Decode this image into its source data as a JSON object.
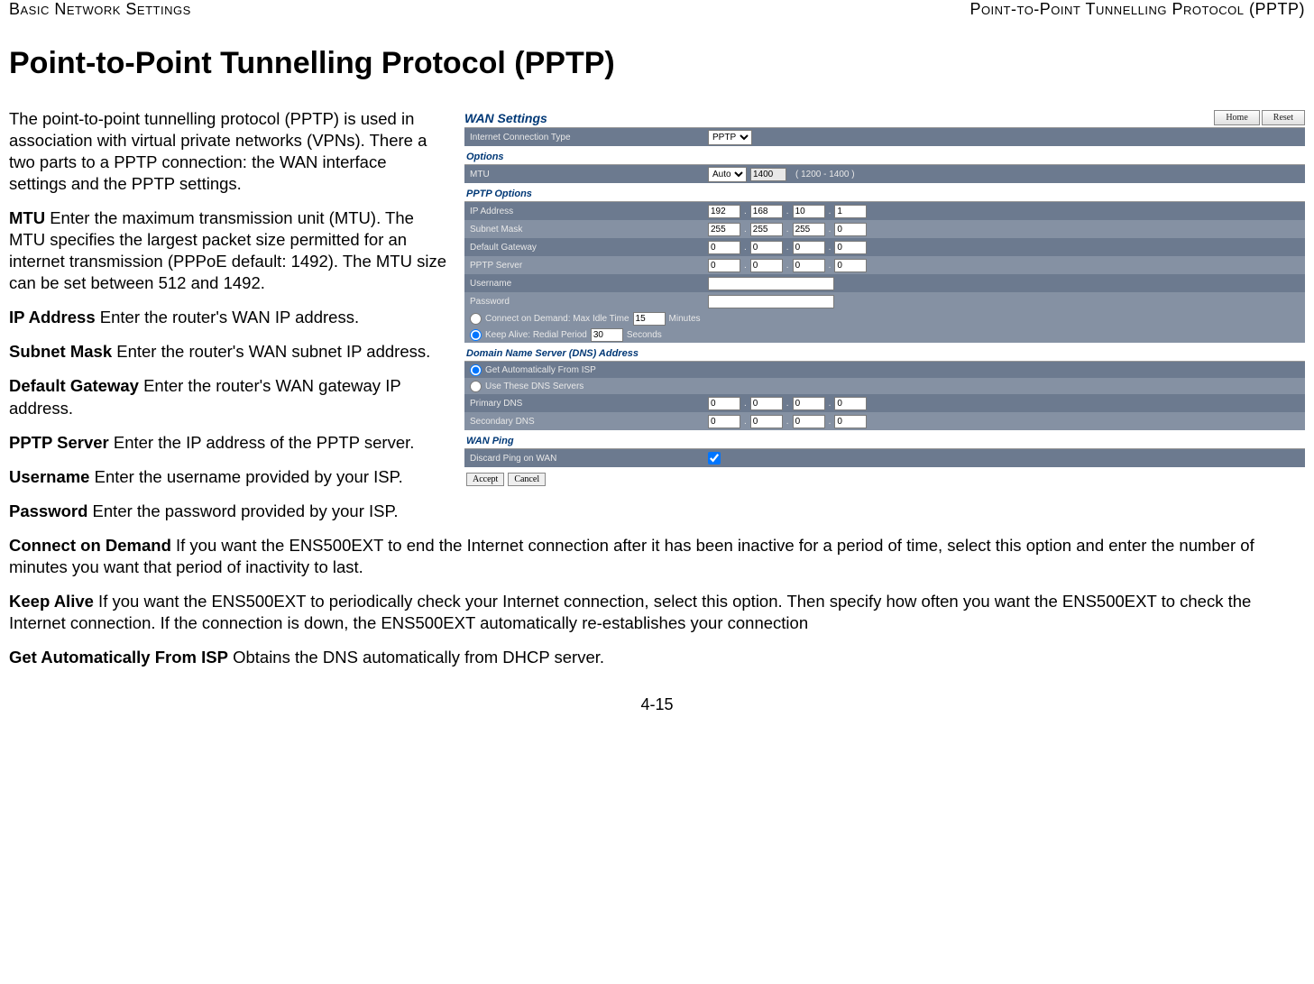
{
  "header": {
    "left": "Basic Network Settings",
    "right": "Point-to-Point Tunnelling Protocol (PPTP)"
  },
  "title": "Point-to-Point Tunnelling Protocol (PPTP)",
  "intro": "The point-to-point tunnelling protocol (PPTP) is used in association with virtual private networks (VPNs). There a two parts to a PPTP connection: the WAN interface settings and the PPTP settings.",
  "mtu": {
    "label": "MTU",
    "text": "  Enter the maximum transmission unit (MTU). The MTU specifies the largest packet size permitted for an internet transmission (PPPoE default: 1492). The MTU size can be set between 512 and 1492."
  },
  "ip": {
    "label": "IP Address",
    "text": "  Enter the router's WAN IP address."
  },
  "subnet": {
    "label": "Subnet Mask",
    "text": "  Enter the router's WAN subnet IP address."
  },
  "gateway": {
    "label": "Default Gateway",
    "text": "  Enter the router's WAN gateway IP address."
  },
  "pptpserver": {
    "label": "PPTP Server",
    "text": "  Enter the IP address of the PPTP server."
  },
  "username": {
    "label": "Username",
    "text": "  Enter the username provided by your ISP."
  },
  "password": {
    "label": "Password",
    "text": "  Enter the password provided by your ISP."
  },
  "cod": {
    "label": "Connect on Demand",
    "text": "  If you want the ENS500EXT to end the Internet connection after it has been inactive for a period of time, select this option and enter the number of minutes you want that period of inactivity to last."
  },
  "keepalive": {
    "label": "Keep Alive",
    "text": "  If you want the ENS500EXT to periodically check your Internet connection, select this option. Then specify how often you want the ENS500EXT to check the Internet connection. If the connection is down, the ENS500EXT automatically re-establishes your connection"
  },
  "getauto": {
    "label": "Get Automatically From ISP",
    "text": "  Obtains the DNS automatically from DHCP server."
  },
  "footer": "4-15",
  "ss": {
    "wan_title": "WAN Settings",
    "home": "Home",
    "reset": "Reset",
    "ict_label": "Internet Connection Type",
    "ict_value": "PPTP",
    "options": "Options",
    "mtu_label": "MTU",
    "mtu_mode": "Auto",
    "mtu_value": "1400",
    "mtu_hint": "( 1200 - 1400 )",
    "pptp_options": "PPTP Options",
    "ip_label": "IP Address",
    "ip": [
      "192",
      "168",
      "10",
      "1"
    ],
    "sm_label": "Subnet Mask",
    "sm": [
      "255",
      "255",
      "255",
      "0"
    ],
    "dg_label": "Default Gateway",
    "dg": [
      "0",
      "0",
      "0",
      "0"
    ],
    "ps_label": "PPTP Server",
    "ps": [
      "0",
      "0",
      "0",
      "0"
    ],
    "un_label": "Username",
    "pw_label": "Password",
    "cod_label": "Connect on Demand: Max Idle Time",
    "cod_val": "15",
    "cod_unit": "Minutes",
    "ka_label": "Keep Alive: Redial Period",
    "ka_val": "30",
    "ka_unit": "Seconds",
    "dns_title": "Domain Name Server (DNS) Address",
    "dns_auto": "Get Automatically From ISP",
    "dns_use": "Use These DNS Servers",
    "pdns_label": "Primary DNS",
    "pdns": [
      "0",
      "0",
      "0",
      "0"
    ],
    "sdns_label": "Secondary DNS",
    "sdns": [
      "0",
      "0",
      "0",
      "0"
    ],
    "wanping": "WAN Ping",
    "discard": "Discard Ping on WAN",
    "accept": "Accept",
    "cancel": "Cancel"
  }
}
